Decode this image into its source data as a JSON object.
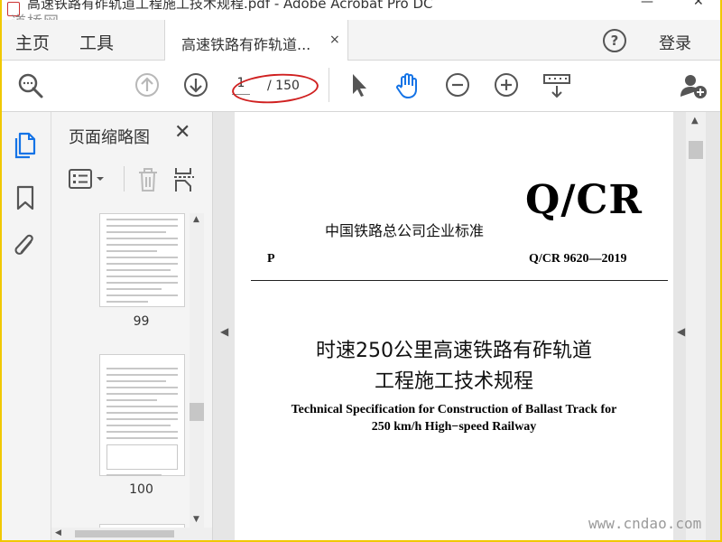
{
  "window": {
    "title": "高速铁路有砟轨道工程施工技术规程.pdf - Adobe Acrobat Pro DC"
  },
  "watermarks": {
    "top_left": "道桥网",
    "bottom_right": "www.cndao.com"
  },
  "tabbar": {
    "home": "主页",
    "tools": "工具",
    "doc_tab": "高速铁路有砟轨道...",
    "close": "×",
    "help": "?",
    "login": "登录"
  },
  "toolbar": {
    "page_current": "1",
    "page_total": "/ 150"
  },
  "panel": {
    "title": "页面缩略图",
    "thumbnails": [
      {
        "page": "99"
      },
      {
        "page": "100"
      }
    ]
  },
  "document": {
    "std_label": "中国铁路总公司企业标准",
    "qcr": "Q/CR",
    "p_letter": "P",
    "std_number": "Q/CR  9620—2019",
    "title_cn_line1": "时速250公里高速铁路有砟轨道",
    "title_cn_line2": "工程施工技术规程",
    "title_en_line1": "Technical Specification for Construction of Ballast Track for",
    "title_en_line2": "250 km/h High−speed Railway"
  },
  "colors": {
    "accent": "#1473e6",
    "annotation": "#d02020",
    "border": "#f0c800"
  }
}
